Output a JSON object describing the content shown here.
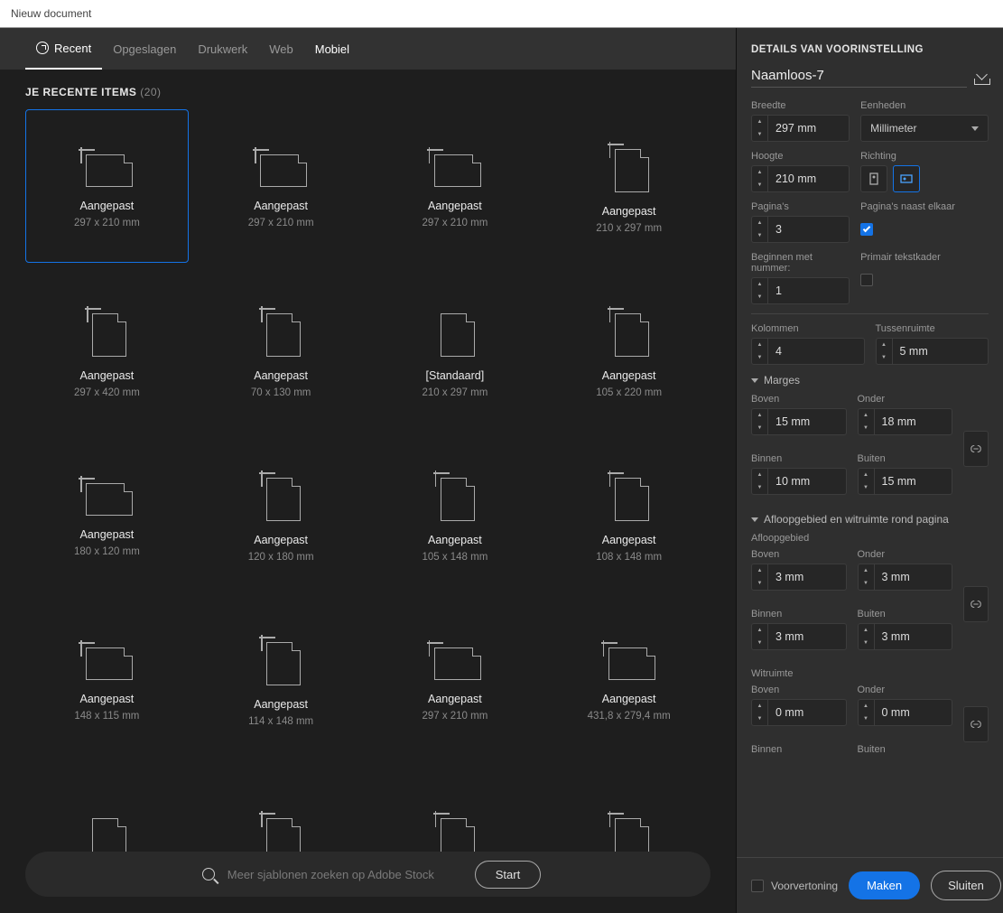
{
  "window_title": "Nieuw document",
  "tabs": [
    "Recent",
    "Opgeslagen",
    "Drukwerk",
    "Web",
    "Mobiel"
  ],
  "active_tab": 0,
  "highlight_tab": 4,
  "items_header": {
    "label": "JE RECENTE ITEMS",
    "count": "(20)"
  },
  "presets": [
    {
      "title": "Aangepast",
      "dims": "297 x 210 mm",
      "orient": "landscape",
      "selected": true
    },
    {
      "title": "Aangepast",
      "dims": "297 x 210 mm",
      "orient": "landscape"
    },
    {
      "title": "Aangepast",
      "dims": "297 x 210 mm",
      "orient": "landscape"
    },
    {
      "title": "Aangepast",
      "dims": "210 x 297 mm",
      "orient": "portrait"
    },
    {
      "title": "Aangepast",
      "dims": "297 x 420 mm",
      "orient": "portrait"
    },
    {
      "title": "Aangepast",
      "dims": "70 x 130 mm",
      "orient": "portrait"
    },
    {
      "title": "[Standaard]",
      "dims": "210 x 297 mm",
      "orient": "portrait",
      "plain": true
    },
    {
      "title": "Aangepast",
      "dims": "105 x 220 mm",
      "orient": "portrait"
    },
    {
      "title": "Aangepast",
      "dims": "180 x 120 mm",
      "orient": "landscape"
    },
    {
      "title": "Aangepast",
      "dims": "120 x 180 mm",
      "orient": "portrait"
    },
    {
      "title": "Aangepast",
      "dims": "105 x 148 mm",
      "orient": "portrait"
    },
    {
      "title": "Aangepast",
      "dims": "108 x 148 mm",
      "orient": "portrait"
    },
    {
      "title": "Aangepast",
      "dims": "148 x 115 mm",
      "orient": "landscape"
    },
    {
      "title": "Aangepast",
      "dims": "114 x 148 mm",
      "orient": "portrait"
    },
    {
      "title": "Aangepast",
      "dims": "297 x 210 mm",
      "orient": "landscape"
    },
    {
      "title": "Aangepast",
      "dims": "431,8 x 279,4 mm",
      "orient": "landscape"
    },
    {
      "title": "",
      "dims": "",
      "orient": "portrait",
      "plain": true
    },
    {
      "title": "",
      "dims": "",
      "orient": "portrait"
    },
    {
      "title": "",
      "dims": "",
      "orient": "portrait"
    },
    {
      "title": "",
      "dims": "",
      "orient": "portrait"
    }
  ],
  "search": {
    "placeholder": "Meer sjablonen zoeken op Adobe Stock",
    "button": "Start"
  },
  "details": {
    "header": "DETAILS VAN VOORINSTELLING",
    "doc_name": "Naamloos-7",
    "width_label": "Breedte",
    "width": "297 mm",
    "units_label": "Eenheden",
    "units": "Millimeter",
    "height_label": "Hoogte",
    "height": "210 mm",
    "orient_label": "Richting",
    "pages_label": "Pagina's",
    "pages": "3",
    "facing_label": "Pagina's naast elkaar",
    "facing": true,
    "start_label": "Beginnen met nummer:",
    "start": "1",
    "primary_tf_label": "Primair tekstkader",
    "primary_tf": false,
    "cols_label": "Kolommen",
    "cols": "4",
    "gutter_label": "Tussenruimte",
    "gutter": "5 mm",
    "margins_label": "Marges",
    "m_top_label": "Boven",
    "m_top": "15 mm",
    "m_bottom_label": "Onder",
    "m_bottom": "18 mm",
    "m_in_label": "Binnen",
    "m_in": "10 mm",
    "m_out_label": "Buiten",
    "m_out": "15 mm",
    "bleed_label": "Afloopgebied en witruimte rond pagina",
    "bleed_section": "Afloopgebied",
    "b_top_label": "Boven",
    "b_top": "3 mm",
    "b_bottom_label": "Onder",
    "b_bottom": "3 mm",
    "b_in_label": "Binnen",
    "b_in": "3 mm",
    "b_out_label": "Buiten",
    "b_out": "3 mm",
    "slug_section": "Witruimte",
    "s_top_label": "Boven",
    "s_top": "0 mm",
    "s_bottom_label": "Onder",
    "s_bottom": "0 mm",
    "s_in_label": "Binnen",
    "s_out_label": "Buiten"
  },
  "footer": {
    "preview": "Voorvertoning",
    "create": "Maken",
    "close": "Sluiten"
  }
}
